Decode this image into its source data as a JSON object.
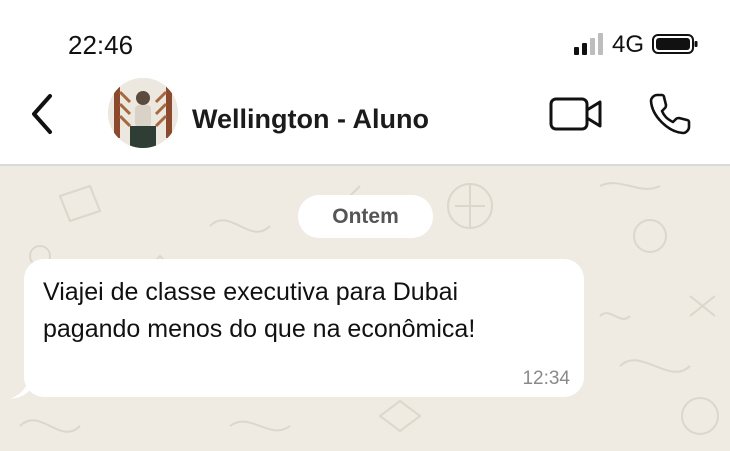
{
  "status_bar": {
    "time": "22:46",
    "network": "4G",
    "icons": [
      "signal-icon",
      "battery-icon"
    ]
  },
  "header": {
    "contact_name": "Wellington - Aluno",
    "icons": [
      "back-icon",
      "video-call-icon",
      "phone-call-icon"
    ]
  },
  "chat": {
    "date_chip": "Ontem",
    "messages": [
      {
        "line1": "Viajei de classe executiva para Dubai",
        "line2": "pagando menos do que na econômica!",
        "time": "12:34",
        "direction": "incoming"
      }
    ]
  },
  "colors": {
    "chat_background": "#efeae2",
    "bubble": "#ffffff",
    "header_divider": "#d9d9d9",
    "timestamp": "#8a8a8a"
  }
}
